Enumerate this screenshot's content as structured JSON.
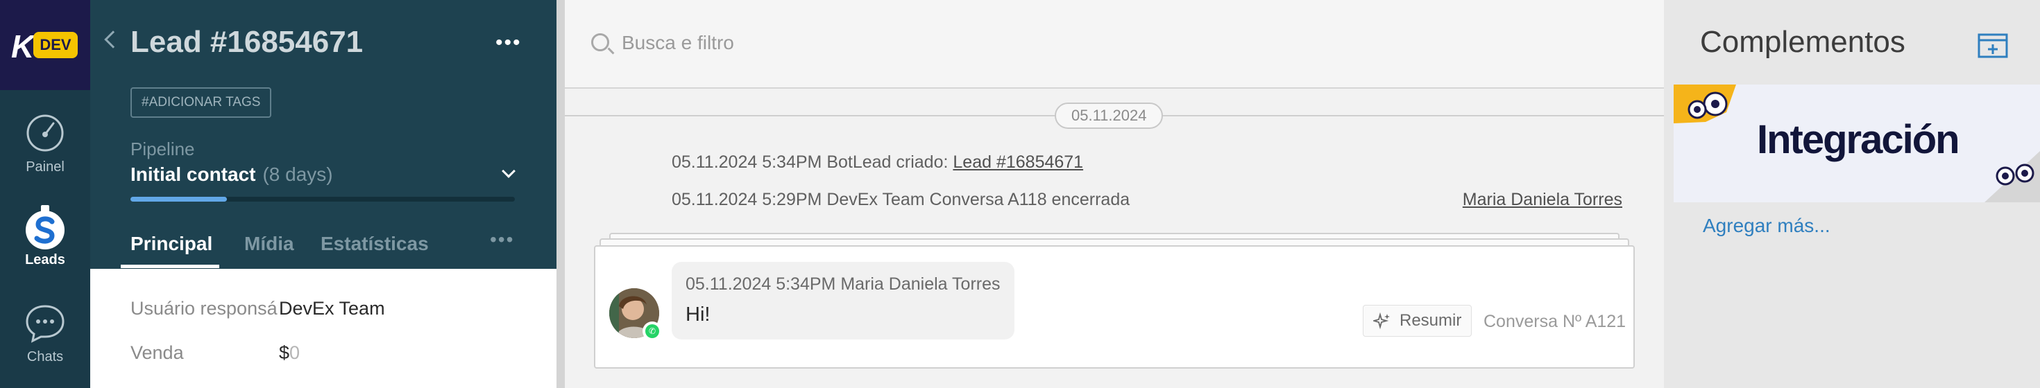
{
  "nav": {
    "logo_letter": "K",
    "logo_badge": "DEV",
    "items": [
      {
        "label": "Painel",
        "icon": "gauge-icon"
      },
      {
        "label": "Leads",
        "icon": "leads-dollar-icon"
      },
      {
        "label": "Chats",
        "icon": "chat-bubble-icon"
      }
    ]
  },
  "lead": {
    "title": "Lead #16854671",
    "tags_button": "#ADICIONAR TAGS",
    "pipeline_label": "Pipeline",
    "stage": "Initial contact",
    "stage_days": "(8 days)",
    "progress_fraction": 0.25,
    "tabs": [
      "Principal",
      "Mídia",
      "Estatísticas"
    ],
    "fields": [
      {
        "label": "Usuário responsável",
        "value": "DevEx Team"
      },
      {
        "label": "Venda",
        "currency": "$",
        "value": "0"
      }
    ]
  },
  "feed": {
    "search_placeholder": "Busca e filtro",
    "date_divider": "05.11.2024",
    "events": [
      {
        "text": "05.11.2024 5:34PM BotLead criado: ",
        "link": "Lead #16854671"
      },
      {
        "text": "05.11.2024 5:29PM DevEx Team Conversa A118 encerrada",
        "right_link": "Maria Daniela Torres"
      }
    ],
    "message": {
      "meta": "05.11.2024 5:34PM Maria Daniela Torres",
      "text": "Hi!",
      "summarize_label": "Resumir",
      "conversation_no": "Conversa Nº A121"
    }
  },
  "right": {
    "title": "Complementos",
    "banner_text": "Integración",
    "more_link": "Agregar más..."
  },
  "colors": {
    "nav_bg": "#1a3a48",
    "lead_bg": "#1e4250",
    "accent_yellow": "#f5c400",
    "progress": "#62a8e8",
    "link_blue": "#2f7fbf"
  }
}
